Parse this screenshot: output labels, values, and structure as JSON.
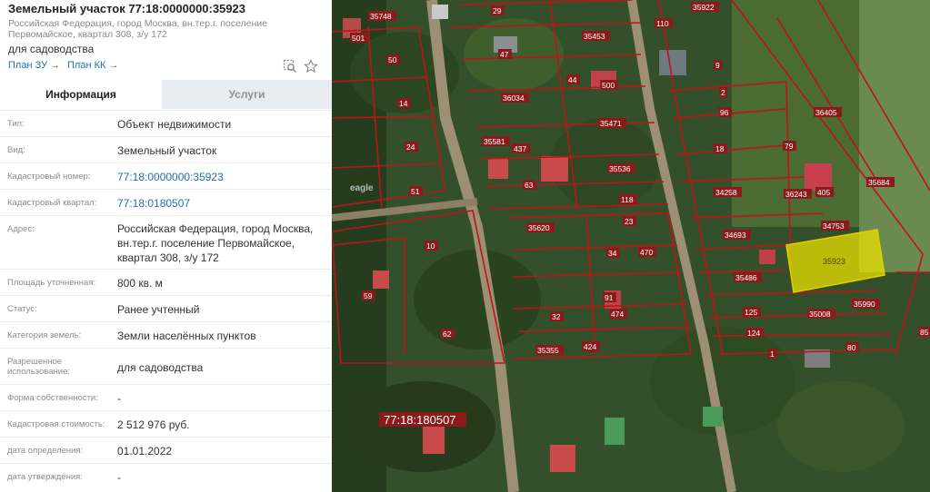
{
  "header": {
    "title": "Земельный участок 77:18:0000000:35923",
    "address_short": "Российская Федерация, город Москва, вн.тер.г. поселение Первомайское, квартал 308, з/у 172",
    "purpose": "для садоводства",
    "plan_zu": "План ЗУ →",
    "plan_kk": "План КК →"
  },
  "tabs": {
    "info": "Информация",
    "services": "Услуги"
  },
  "rows": [
    {
      "key": "Тип:",
      "value": "Объект недвижимости"
    },
    {
      "key": "Вид:",
      "value": "Земельный участок"
    },
    {
      "key": "Кадастровый номер:",
      "value": "77:18:0000000:35923"
    },
    {
      "key": "Кадастровый квартал:",
      "value": "77:18:0180507"
    },
    {
      "key": "Адрес:",
      "value": "Российская Федерация, город Москва, вн.тер.г. поселение Первомайское, квартал 308, з/у 172"
    },
    {
      "key": "Площадь уточненная:",
      "value": "800 кв. м"
    },
    {
      "key": "Статус:",
      "value": "Ранее учтенный"
    },
    {
      "key": "Категория земель:",
      "value": "Земли населённых пунктов"
    },
    {
      "key": "Разрешенное использование:",
      "value": "для садоводства"
    },
    {
      "key": "Форма собственности:",
      "value": "-"
    },
    {
      "key": "Кадастровая стоимость:",
      "value": "2 512 976 руб."
    },
    {
      "key": "дата определения:",
      "value": "01.01.2022"
    },
    {
      "key": "дата утверждения:",
      "value": "-"
    }
  ],
  "map": {
    "quarter_label": "77:18:180507",
    "selected_parcel": "35923",
    "watermark": "eagle",
    "parcel_labels": [
      "35748",
      "29",
      "35922",
      "501",
      "110",
      "47",
      "35453",
      "50",
      "9",
      "44",
      "500",
      "36034",
      "2",
      "14",
      "96",
      "35471",
      "35581",
      "437",
      "18",
      "79",
      "24",
      "35536",
      "34258",
      "36243",
      "405",
      "118",
      "63",
      "51",
      "23",
      "35620",
      "34693",
      "34753",
      "10",
      "34",
      "470",
      "35486",
      "59",
      "91",
      "32",
      "474",
      "125",
      "35008",
      "35990",
      "62",
      "124",
      "35355",
      "424",
      "1",
      "80",
      "85",
      "36405",
      "35684"
    ],
    "colors": {
      "parcel_border": "#c0121b",
      "selected_fill": "#e8e000",
      "label_bg": "#8b1a1a"
    }
  }
}
